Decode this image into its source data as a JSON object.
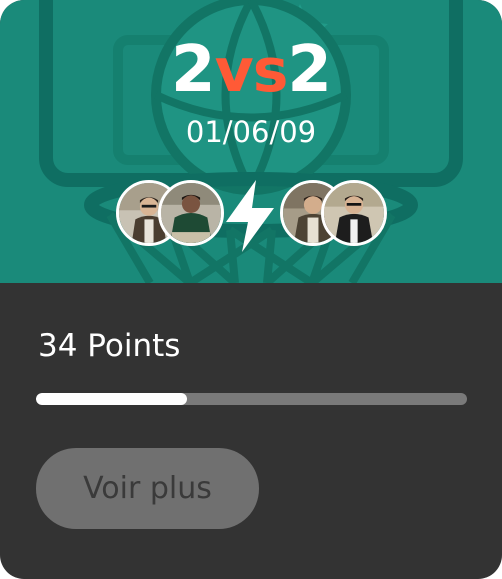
{
  "match": {
    "title_left": "2",
    "title_vs": "vs",
    "title_right": "2",
    "date": "01/06/09"
  },
  "team_a": [
    {
      "icon": "player-avatar"
    },
    {
      "icon": "player-avatar"
    }
  ],
  "team_b": [
    {
      "icon": "player-avatar"
    },
    {
      "icon": "player-avatar"
    }
  ],
  "score": {
    "label": "34 Points",
    "progress_percent": 35
  },
  "actions": {
    "more_label": "Voir plus"
  },
  "colors": {
    "hero": "#1a8a7a",
    "accent": "#ff5a36",
    "panel": "#333333",
    "button": "#707070"
  }
}
